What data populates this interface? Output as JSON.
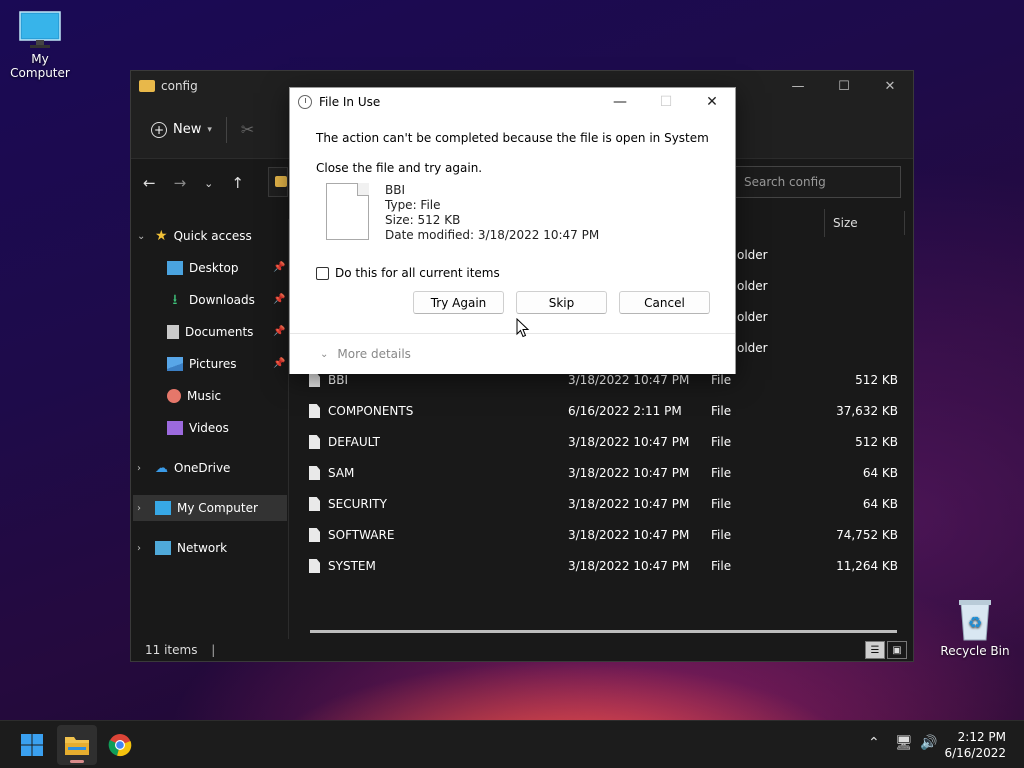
{
  "desktop": {
    "icons": [
      {
        "label": "My Computer"
      },
      {
        "label": "Recycle Bin"
      }
    ]
  },
  "explorer": {
    "title": "config",
    "toolbar": {
      "new_label": "New"
    },
    "search_placeholder": "Search config",
    "column_size": "Size",
    "sidebar": {
      "quick_access": "Quick access",
      "items": [
        {
          "label": "Desktop",
          "icon": "desktop-icon",
          "color": "#4aa3df"
        },
        {
          "label": "Downloads",
          "icon": "download-icon",
          "color": "#3fc17a"
        },
        {
          "label": "Documents",
          "icon": "documents-icon",
          "color": "#c9c9c9"
        },
        {
          "label": "Pictures",
          "icon": "pictures-icon",
          "color": "#58a6e8"
        },
        {
          "label": "Music",
          "icon": "music-icon",
          "color": "#e5776a"
        },
        {
          "label": "Videos",
          "icon": "videos-icon",
          "color": "#9c6ade"
        }
      ],
      "onedrive": "OneDrive",
      "my_computer": "My Computer",
      "network": "Network"
    },
    "partial_type": "older",
    "files": [
      {
        "name": "BBI",
        "date": "3/18/2022 10:47 PM",
        "type": "File",
        "size": "512 KB"
      },
      {
        "name": "COMPONENTS",
        "date": "6/16/2022 2:11 PM",
        "type": "File",
        "size": "37,632 KB"
      },
      {
        "name": "DEFAULT",
        "date": "3/18/2022 10:47 PM",
        "type": "File",
        "size": "512 KB"
      },
      {
        "name": "SAM",
        "date": "3/18/2022 10:47 PM",
        "type": "File",
        "size": "64 KB"
      },
      {
        "name": "SECURITY",
        "date": "3/18/2022 10:47 PM",
        "type": "File",
        "size": "64 KB"
      },
      {
        "name": "SOFTWARE",
        "date": "3/18/2022 10:47 PM",
        "type": "File",
        "size": "74,752 KB"
      },
      {
        "name": "SYSTEM",
        "date": "3/18/2022 10:47 PM",
        "type": "File",
        "size": "11,264 KB"
      }
    ],
    "status": "11 items"
  },
  "dialog": {
    "title": "File In Use",
    "message": "The action can't be completed because the file is open in System",
    "instruction": "Close the file and try again.",
    "file": {
      "name": "BBI",
      "type": "Type: File",
      "size": "Size: 512 KB",
      "modified": "Date modified: 3/18/2022 10:47 PM"
    },
    "checkbox_label": "Do this for all current items",
    "buttons": {
      "try_again": "Try Again",
      "skip": "Skip",
      "cancel": "Cancel"
    },
    "more_details": "More details"
  },
  "taskbar": {
    "time": "2:12 PM",
    "date": "6/16/2022"
  }
}
